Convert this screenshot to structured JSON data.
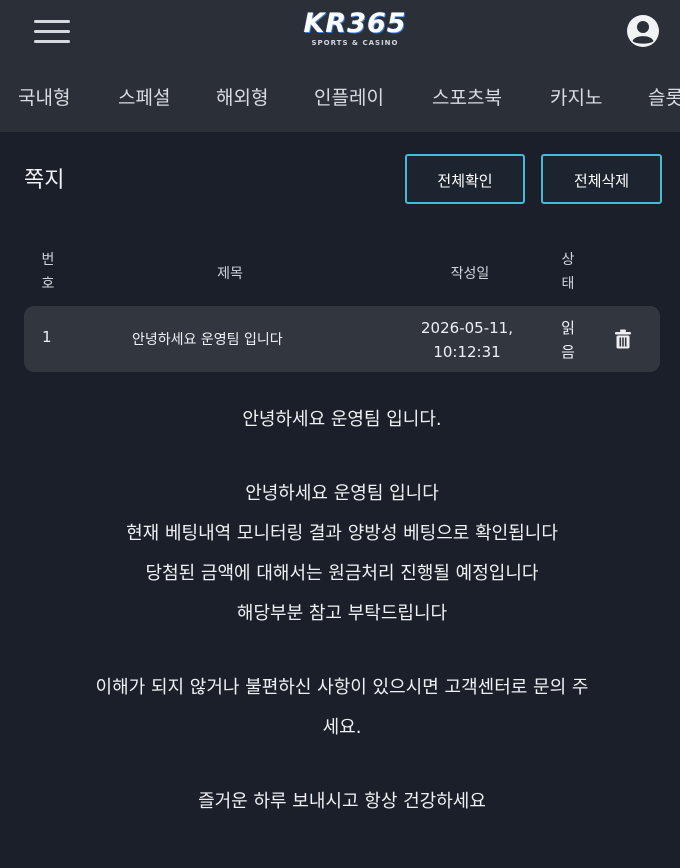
{
  "header": {
    "logo_main": "KR365",
    "logo_sub": "SPORTS & CASINO"
  },
  "nav": {
    "items": [
      "국내형",
      "스페셜",
      "해외형",
      "인플레이",
      "스포츠북",
      "카지노",
      "슬롯"
    ]
  },
  "messages_page": {
    "title": "쪽지",
    "read_all_label": "전체확인",
    "delete_all_label": "전체삭제",
    "columns": {
      "no_line1": "번",
      "no_line2": "호",
      "title": "제목",
      "date": "작성일",
      "status_line1": "상",
      "status_line2": "태"
    },
    "row": {
      "no": "1",
      "title": "안녕하세요 운영팀 입니다",
      "date_line1": "2026-05-11,",
      "date_line2": "10:12:31",
      "status_line1": "읽",
      "status_line2": "음"
    },
    "body": {
      "heading": "안녕하세요 운영팀 입니다.",
      "line1": "안녕하세요 운영팀 입니다",
      "line2": "현재 베팅내역 모니터링 결과 양방성 베팅으로 확인됩니다",
      "line3": "당첨된 금액에 대해서는 원금처리 진행될 예정입니다",
      "line4": "해당부분 참고 부탁드립니다",
      "line5a": "이해가 되지 않거나 불편하신 사항이 있으시면 고객센터로 문의 주",
      "line5b": "세요.",
      "line6": "즐거운 하루 보내시고 항상 건강하세요"
    }
  },
  "colors": {
    "background": "#1a1f29",
    "header": "#2b2f37",
    "row": "#32363f",
    "button_border": "#4bb9d4"
  },
  "icons": {
    "menu": "hamburger-icon",
    "profile": "user-circle-icon",
    "delete": "trash-icon"
  }
}
